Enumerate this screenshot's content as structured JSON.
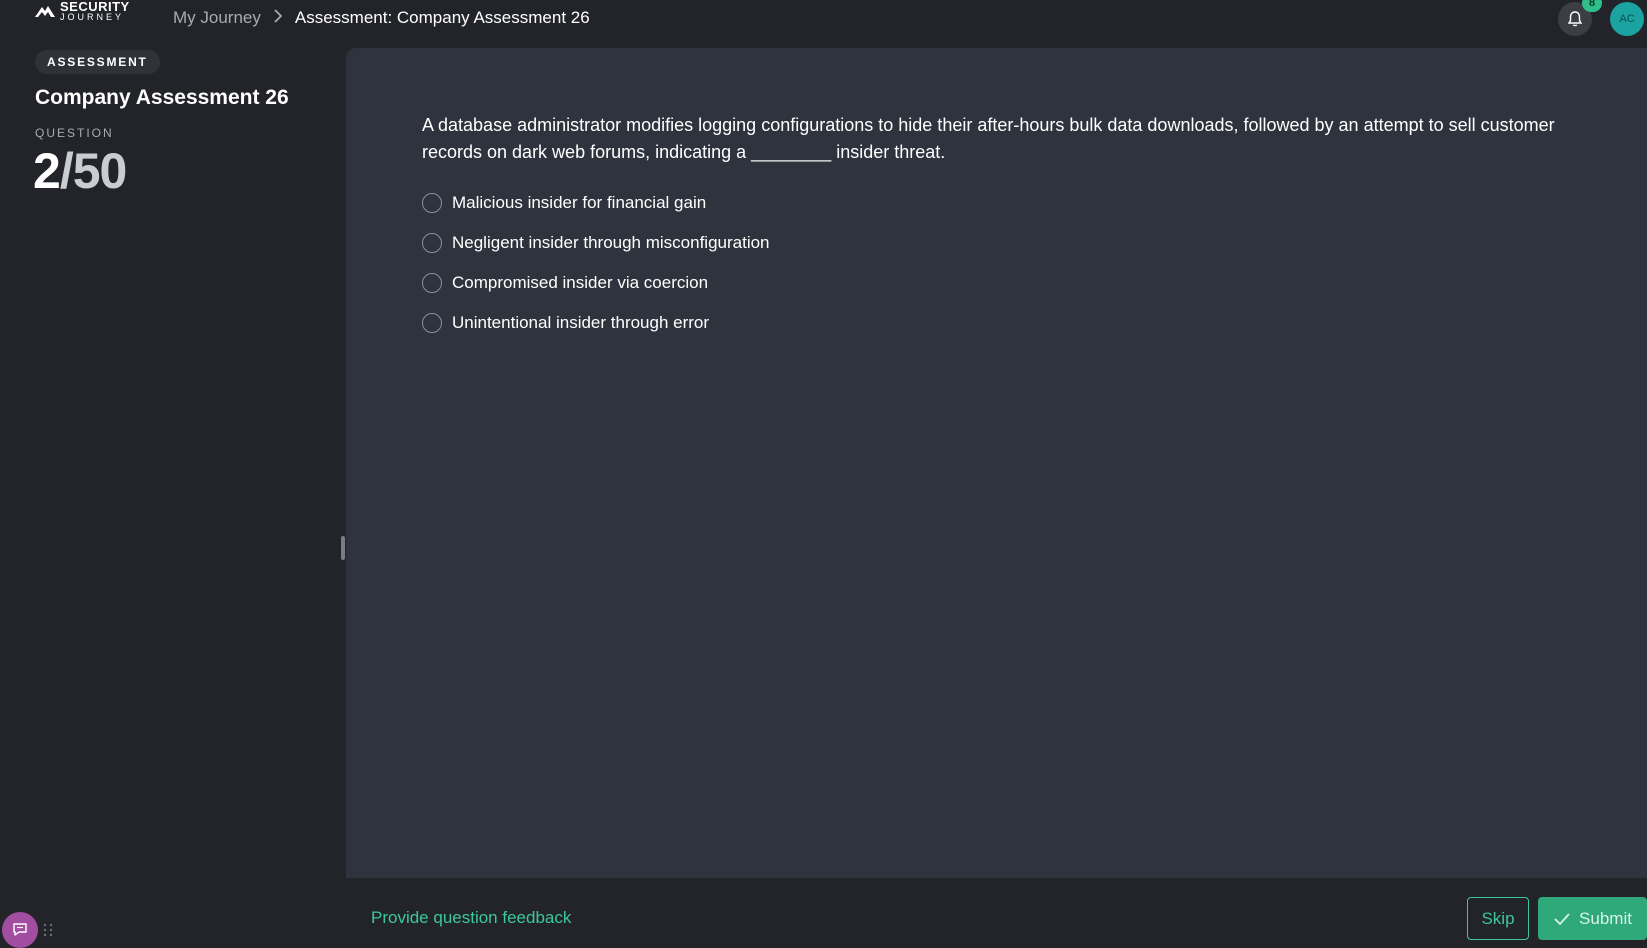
{
  "brand": {
    "line1": "SECURITY",
    "line2": "JOURNEY",
    "icon": "mountain-logo-icon"
  },
  "breadcrumb": {
    "root": "My Journey",
    "separator_icon": "chevron-right-icon",
    "current": "Assessment: Company Assessment 26"
  },
  "header": {
    "notifications_icon": "bell-icon",
    "notification_count": "8",
    "avatar_initials": "AC"
  },
  "sidebar": {
    "tag": "ASSESSMENT",
    "title": "Company Assessment 26",
    "question_label": "QUESTION",
    "question_current": "2",
    "question_separator": "/",
    "question_total": "50"
  },
  "question": {
    "text": "A database administrator modifies logging configurations to hide their after-hours bulk data downloads, followed by an attempt to sell customer records on dark web forums, indicating a ________ insider threat.",
    "options": [
      {
        "label": "Malicious insider for financial gain",
        "selected": false
      },
      {
        "label": "Negligent insider through misconfiguration",
        "selected": false
      },
      {
        "label": "Compromised insider via coercion",
        "selected": false
      },
      {
        "label": "Unintentional insider through error",
        "selected": false
      }
    ]
  },
  "footer": {
    "feedback_link": "Provide question feedback",
    "skip_label": "Skip",
    "submit_label": "Submit",
    "submit_icon": "checkmark-icon"
  },
  "widgets": {
    "chat_icon": "chat-bubble-icon",
    "drag_icon": "drag-handle-icon"
  },
  "colors": {
    "accent": "#3cc89a",
    "submit_bg": "#2fa87a",
    "panel_bg": "#2e333d",
    "page_bg": "#222429",
    "avatar_bg": "#1aa3a0",
    "chat_bg": "#a14ea0"
  }
}
